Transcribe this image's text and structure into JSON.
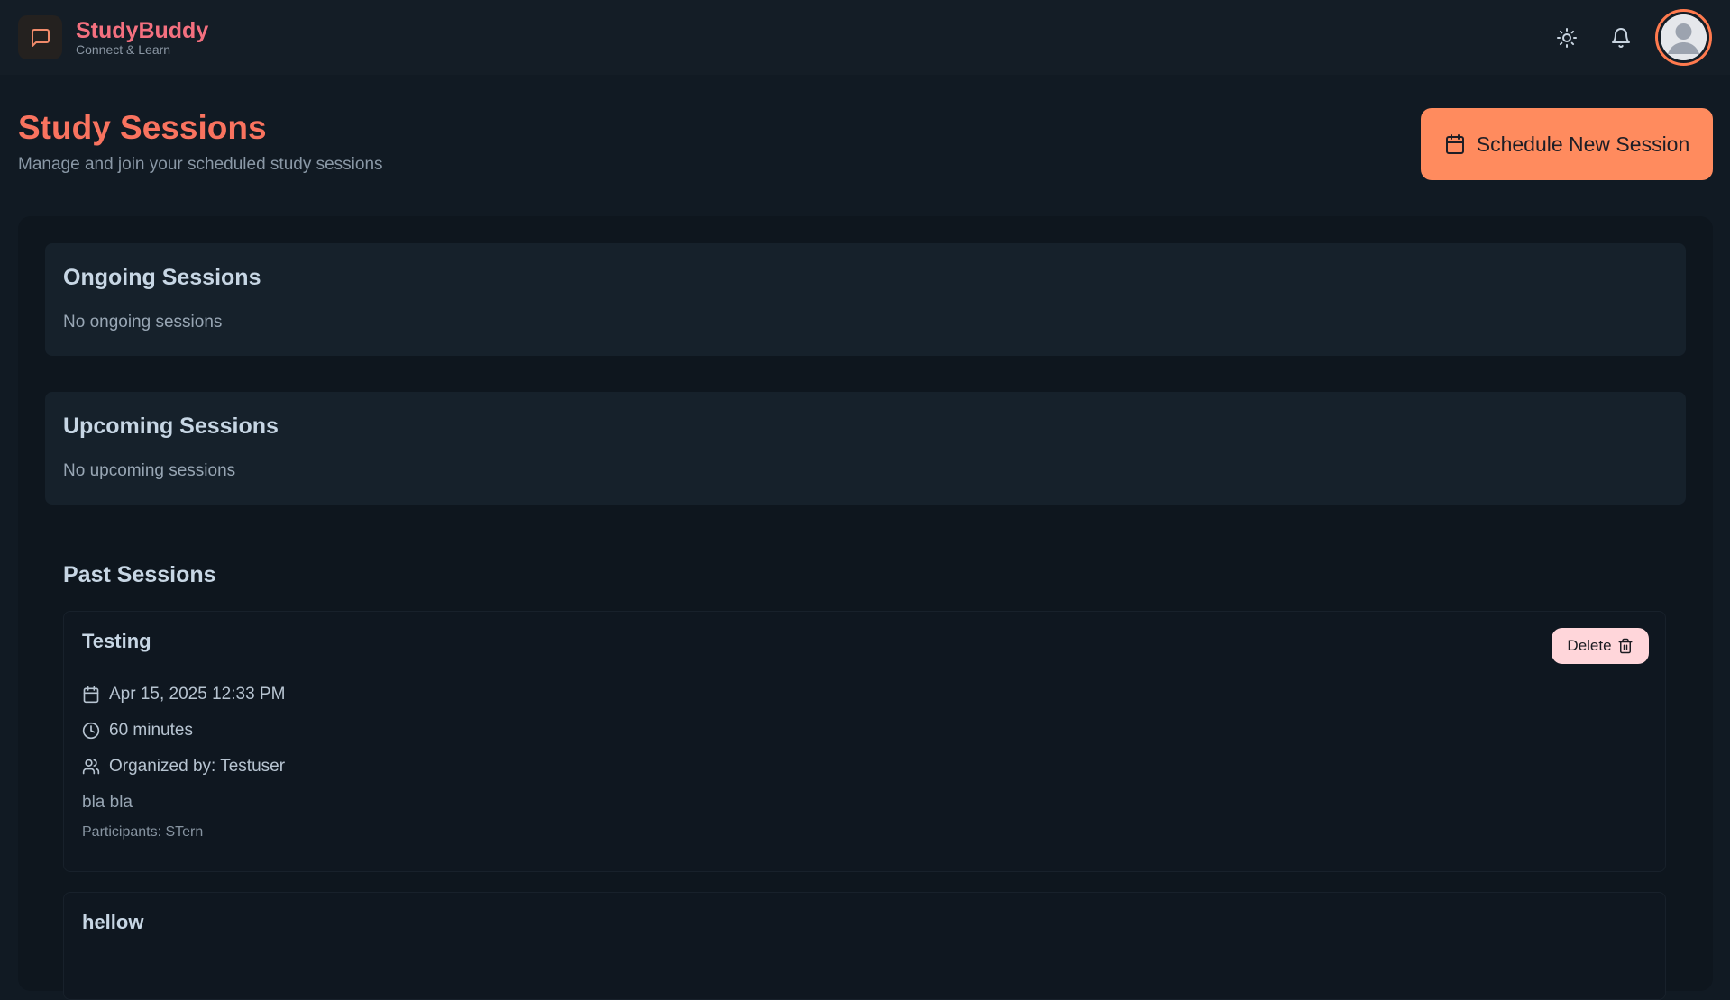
{
  "brand": {
    "name": "StudyBuddy",
    "tagline": "Connect & Learn"
  },
  "header_icons": {
    "theme": "sun-icon",
    "notifications": "bell-icon",
    "avatar": "user-avatar-icon"
  },
  "page": {
    "title": "Study Sessions",
    "subtitle": "Manage and join your scheduled study sessions",
    "schedule_button": "Schedule New Session"
  },
  "ongoing": {
    "title": "Ongoing Sessions",
    "empty": "No ongoing sessions"
  },
  "upcoming": {
    "title": "Upcoming Sessions",
    "empty": "No upcoming sessions"
  },
  "past": {
    "title": "Past Sessions",
    "sessions": [
      {
        "name": "Testing",
        "datetime": "Apr 15, 2025 12:33 PM",
        "duration": "60 minutes",
        "organizer": "Organized by: Testuser",
        "description": "bla bla",
        "participants": "Participants: STern",
        "delete_label": "Delete"
      },
      {
        "name": "hellow"
      }
    ]
  },
  "colors": {
    "accent": "#ff8b5e",
    "brand": "#f4707f",
    "title": "#f9735f",
    "danger_bg": "#ffd6da"
  }
}
